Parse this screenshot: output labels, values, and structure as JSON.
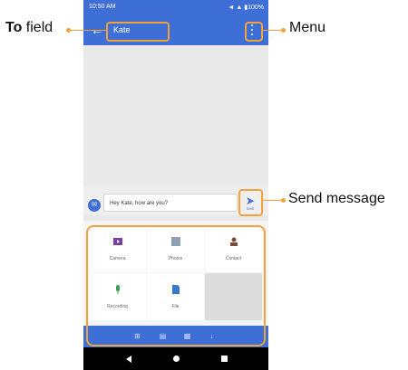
{
  "status_bar": {
    "time": "10:50 AM",
    "indicators": "◄ ▲ ▮100%"
  },
  "app_bar": {
    "back_icon": "arrow-left-icon",
    "to_field_value": "Kate",
    "menu_icon": "overflow-menu-icon"
  },
  "compose": {
    "avatar_icon": "message-icon",
    "message_text": "Hey Kate, how are you?",
    "send_label": "SMS"
  },
  "attachments": [
    {
      "label": "Camera",
      "icon": "camera-icon",
      "color": "#7b3ea8"
    },
    {
      "label": "Photos",
      "icon": "photos-icon",
      "color": "#8fa0b5"
    },
    {
      "label": "Contact",
      "icon": "contact-icon",
      "color": "#7a4a3a"
    },
    {
      "label": "Recording",
      "icon": "microphone-icon",
      "color": "#3aa05a"
    },
    {
      "label": "File",
      "icon": "file-icon",
      "color": "#3a78c8"
    }
  ],
  "attach_tabs": [
    "grid-icon",
    "image-icon",
    "calendar-icon",
    "microphone-icon"
  ],
  "callouts": {
    "to_field_bold": "To",
    "to_field_rest": " field",
    "menu": "Menu",
    "send_message": "Send message"
  },
  "colors": {
    "accent": "#3d6fd6",
    "callout": "#f2a23a"
  }
}
